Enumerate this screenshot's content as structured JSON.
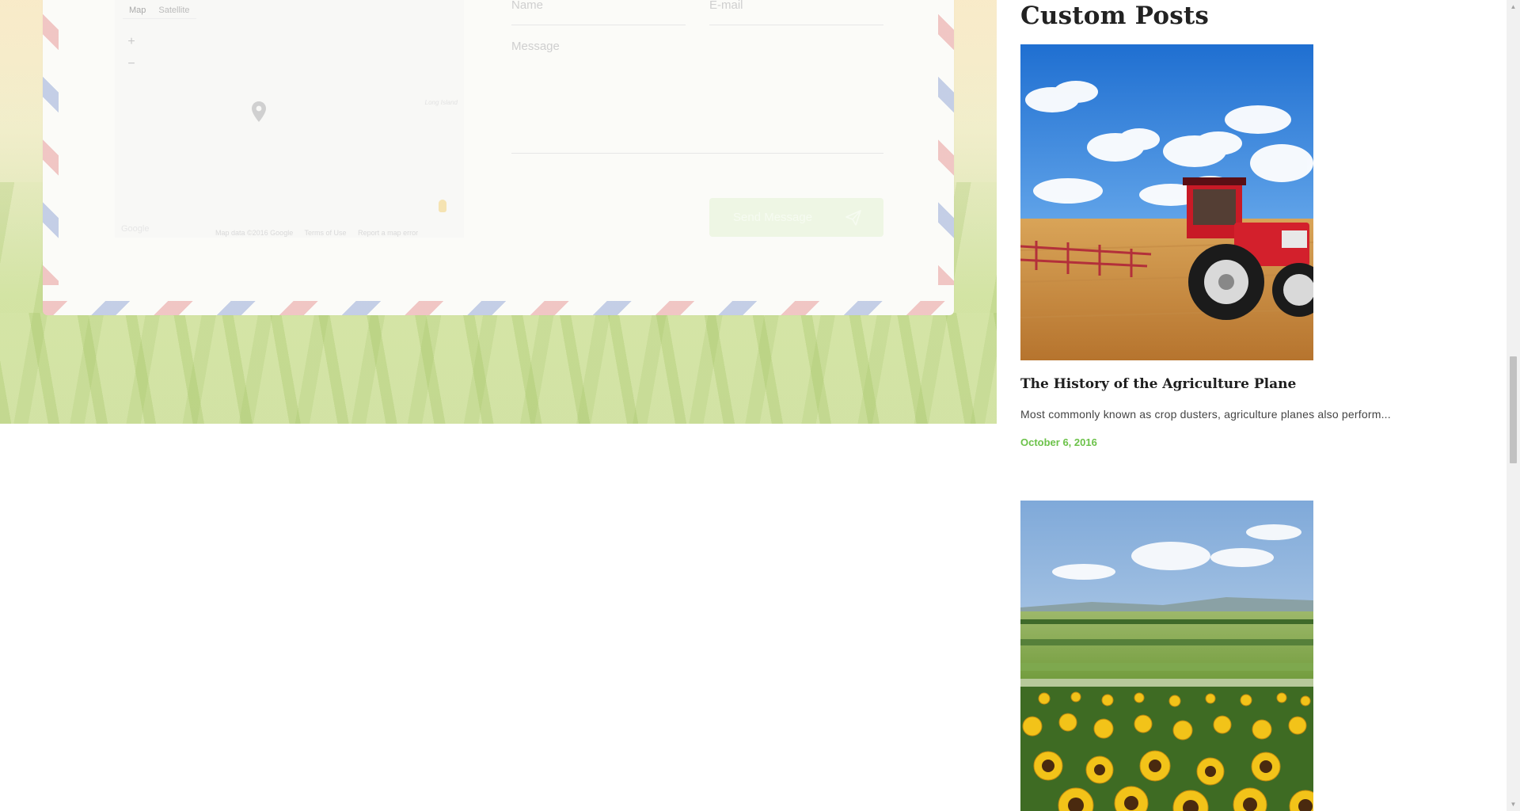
{
  "contact": {
    "map": {
      "tabs": [
        "Map",
        "Satellite"
      ],
      "zoom_in": "+",
      "zoom_out": "−",
      "credit": "Long Island",
      "google": "Google",
      "footer": [
        "Map data ©2016 Google",
        "Terms of Use",
        "Report a map error"
      ]
    },
    "form": {
      "name_placeholder": "Name",
      "email_placeholder": "E-mail",
      "message_placeholder": "Message",
      "send_label": "Send Message"
    }
  },
  "sidebar": {
    "title": "Custom Posts",
    "posts": [
      {
        "title": "The History of the Agriculture Plane",
        "excerpt": "Most commonly known as crop dusters, agriculture planes also perform...",
        "date": "October 6, 2016",
        "image": "red tractor in plowed field"
      },
      {
        "image": "sunflower field landscape"
      }
    ]
  },
  "colors": {
    "accent": "#6cc24a",
    "title": "#222222",
    "card": "#fbfbf8"
  },
  "icons": {
    "map_pin": "map-pin-icon",
    "send": "paper-plane-icon",
    "scroll_up": "chevron-up-icon",
    "scroll_down": "chevron-down-icon"
  }
}
